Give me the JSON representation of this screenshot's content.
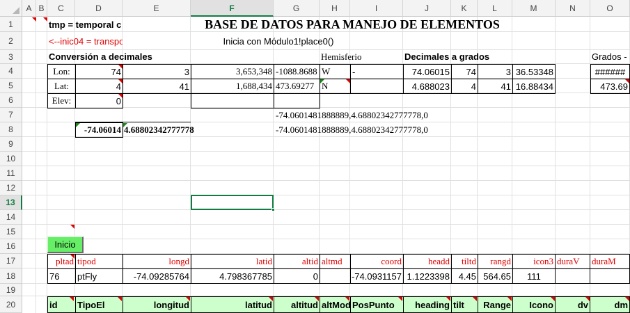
{
  "columns": [
    "A",
    "B",
    "C",
    "D",
    "E",
    "F",
    "G",
    "H",
    "I",
    "J",
    "K",
    "L",
    "M",
    "N",
    "O"
  ],
  "rows": [
    "1",
    "2",
    "3",
    "4",
    "5",
    "6",
    "7",
    "8",
    "9",
    "10",
    "11",
    "12",
    "13",
    "14",
    "15",
    "16",
    "17",
    "18",
    "19",
    "20"
  ],
  "active_cell": "F13",
  "cells": {
    "C1": "tmp = temporal c",
    "F1": "BASE DE DATOS PARA MANEJO DE ELEMENTOS",
    "C2": "<--inic04 = transpo",
    "F2": "Inicia con Módulo1!place0()",
    "C3": "Conversión a decimales",
    "H3": "Hemisferio",
    "J3": "Decimales a grados",
    "O3": "Grados -",
    "C4": "Lon:",
    "D4": "74",
    "E4": "3",
    "F4": "3,653,348",
    "G4": "-1088.8688",
    "H4": "W",
    "I4": "-",
    "J4": "74.06015",
    "K4": "74",
    "L4": "3",
    "M4": "36.53348",
    "O4": "######",
    "C5": "Lat:",
    "D5": "4",
    "E5": "41",
    "F5": "1,688,434",
    "G5": "473.69277",
    "H5": "N",
    "J5": "4.688023",
    "K5": "4",
    "L5": "41",
    "M5": "16.88434",
    "O5": "473.69",
    "C6": "Elev:",
    "D6": "0",
    "G7": "-74.0601481888889,4.68802342777778,0",
    "D8": "-74.06014",
    "E8": "4.68802342777778",
    "G8": "-74.0601481888889,4.68802342777778,0",
    "C17": "pltad",
    "D17": "tipod",
    "E17": "longd",
    "F17": "latid",
    "G17": "altid",
    "H17": "altmd",
    "I17": "coord",
    "J17": "headd",
    "K17": "tiltd",
    "L17": "rangd",
    "M17": "icon3",
    "N17": "duraV",
    "O17": "duraM",
    "C18": "76",
    "D18": "ptFly",
    "E18": "-74.09285764",
    "F18": "4.798367785",
    "G18": "0",
    "I18": "-74.0931157",
    "J18": "1.1223398",
    "K18": "4.45",
    "L18": "564.65",
    "M18": "111",
    "C20": "id",
    "D20": "TipoEl",
    "E20": "longitud",
    "F20": "latitud",
    "G20": "altitud",
    "H20": "altMod",
    "I20": "PosPunto",
    "J20": "heading",
    "K20": "tilt",
    "L20": "Range",
    "M20": "Icono",
    "N20": "dv",
    "O20": "dm"
  },
  "button": {
    "label": "Inicio"
  },
  "colors": {
    "text_red": "#e00000",
    "header_green": "#ccffcc",
    "button_green": "#66ee66",
    "selection": "#107c41"
  }
}
